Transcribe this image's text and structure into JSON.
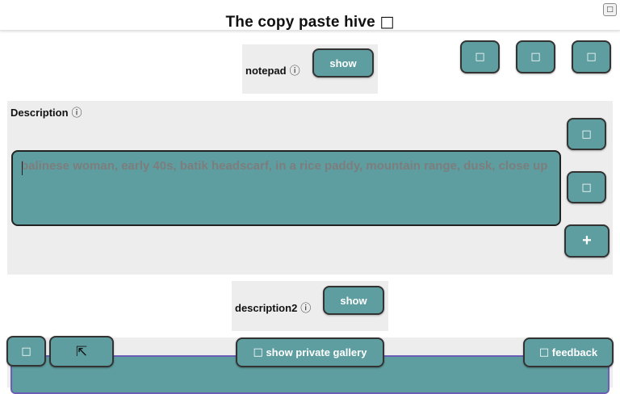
{
  "header": {
    "title": "The copy paste hive",
    "title_icon": "bee-icon",
    "corner_icon": "menu-icon"
  },
  "notepad": {
    "label": "notepad",
    "info_icon": "ⓘ",
    "show_label": "show"
  },
  "toolbar": {
    "icons": [
      "tool-icon-1",
      "tool-icon-2",
      "tool-icon-3"
    ]
  },
  "description": {
    "label": "Description",
    "info_icon": "ⓘ",
    "placeholder": "balinese woman, early 40s, batik headscarf, in a rice paddy, mountain range, dusk, close up",
    "side_icons": [
      "action-icon-1",
      "action-icon-2"
    ],
    "add_label": "+"
  },
  "description2": {
    "label": "description2",
    "info_icon": "ⓘ",
    "show_label": "show"
  },
  "bottom": {
    "corner_arrow": "⇱",
    "gallery_label": "show private gallery",
    "feedback_label": "feedback"
  },
  "colors": {
    "accent": "#5f9ea0",
    "panel": "#ededed",
    "border": "#333333",
    "gallery_border": "#6b5fb5"
  }
}
